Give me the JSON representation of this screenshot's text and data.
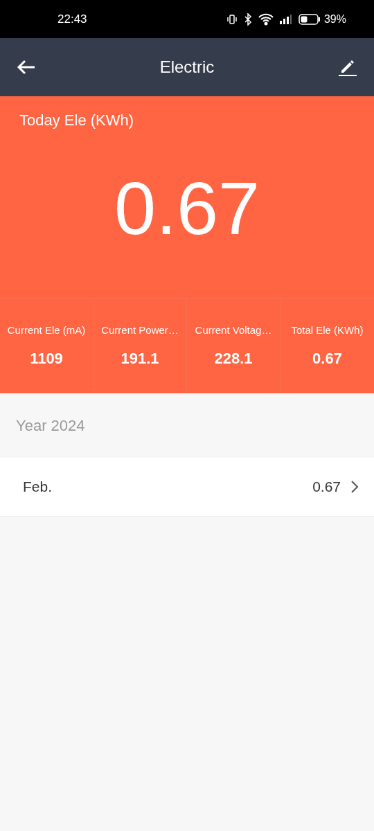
{
  "status_bar": {
    "time": "22:43",
    "battery": "39%"
  },
  "header": {
    "title": "Electric"
  },
  "today": {
    "label": "Today Ele (KWh)",
    "value": "0.67"
  },
  "stats": [
    {
      "label": "Current Ele (mA)",
      "value": "1109"
    },
    {
      "label": "Current Power…",
      "value": "191.1"
    },
    {
      "label": "Current Voltag…",
      "value": "228.1"
    },
    {
      "label": "Total Ele (KWh)",
      "value": "0.67"
    }
  ],
  "year": {
    "label": "Year 2024"
  },
  "months": [
    {
      "label": "Feb.",
      "value": "0.67"
    }
  ]
}
